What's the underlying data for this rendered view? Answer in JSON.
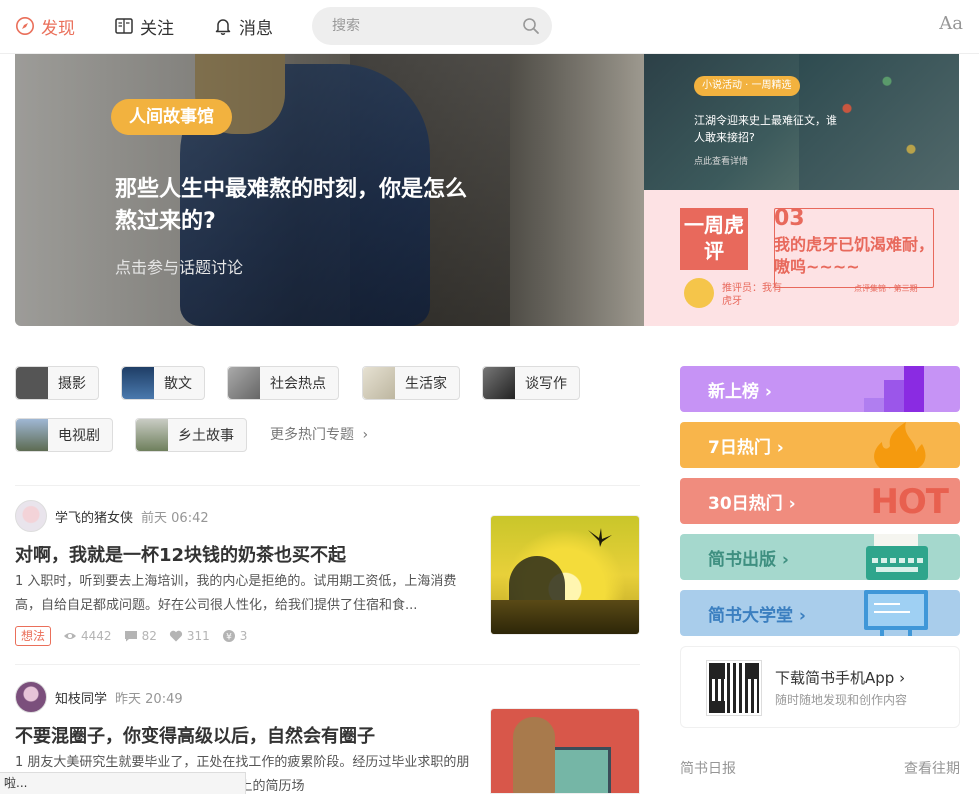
{
  "nav": {
    "discover": "发现",
    "follow": "关注",
    "messages": "消息",
    "search_placeholder": "搜索",
    "font_toggle": "Aa",
    "accent_color": "#ea6f5a"
  },
  "banner": {
    "main": {
      "tag": "人间故事馆",
      "title": "那些人生中最难熬的时刻，你是怎么熬过来的?",
      "subtitle": "点击参与话题讨论"
    },
    "side1": {
      "tag": "小说活动 · 一周精选",
      "title": "江湖令迎来史上最难征文，谁人敢来接招?",
      "subtitle": "点此查看详情"
    },
    "side2": {
      "logo": "一周虎评",
      "issue_no": "03",
      "title": "我的虎牙已饥渴难耐，嗷呜~~~~",
      "reviewer": "推评员：我有虎牙",
      "issue_label": "点评集锦 · 第三期"
    }
  },
  "topics": [
    {
      "label": "摄影",
      "thumb_color": "#555"
    },
    {
      "label": "散文",
      "thumb_color": "#2e5a8c"
    },
    {
      "label": "社会热点",
      "thumb_color": "#888"
    },
    {
      "label": "生活家",
      "thumb_color": "#cfc8b4"
    },
    {
      "label": "谈写作",
      "thumb_color": "#444"
    },
    {
      "label": "电视剧",
      "thumb_color": "#6a86a8"
    },
    {
      "label": "乡土故事",
      "thumb_color": "#7a8a6a"
    }
  ],
  "more_topics": "更多热门专题",
  "articles": [
    {
      "author": "学飞的猪女侠",
      "time": "前天 06:42",
      "title": "对啊，我就是一杯12块钱的奶茶也买不起",
      "abstract": "1 入职时，听到要去上海培训，我的内心是拒绝的。试用期工资低，上海消费高，自给自足都成问题。好在公司很人性化，给我们提供了住宿和食...",
      "badge": "想法",
      "views": "4442",
      "comments": "82",
      "likes": "311",
      "rewards": "3"
    },
    {
      "author": "知枝同学",
      "time": "昨天 20:49",
      "title": "不要混圈子，你变得高级以后，自然会有圈子",
      "abstract": "1 朋友大美研究生就要毕业了，正处在找工作的疲累阶段。经历过毕业求职的朋友都知道，这一场，你手里握着10份以上的简历场"
    }
  ],
  "sidebar": {
    "boards": [
      {
        "label": "新上榜",
        "color": "#c693f5"
      },
      {
        "label": "7日热门",
        "color": "#f8b54b"
      },
      {
        "label": "30日热门",
        "color": "#f08c7e"
      },
      {
        "label": "简书出版",
        "color": "#a5d8cd"
      },
      {
        "label": "简书大学堂",
        "color": "#a9cdeb"
      }
    ],
    "hot_text": "HOT",
    "download_title": "下载简书手机App",
    "download_sub": "随时随地发现和创作内容",
    "daily": "简书日报",
    "past": "查看往期"
  },
  "status_hint": "啦..."
}
